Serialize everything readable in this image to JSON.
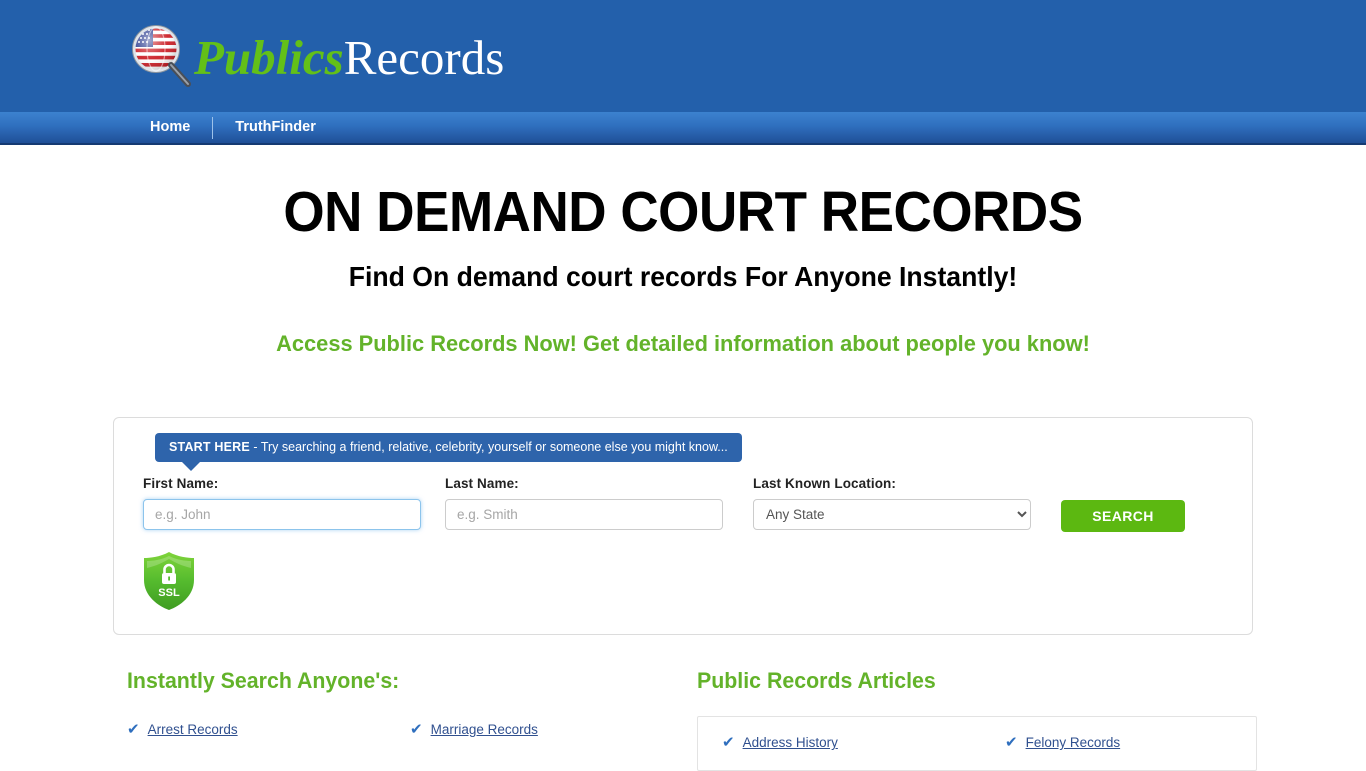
{
  "header": {
    "logo": {
      "icon": "magnifier-usflag-icon",
      "text_green": "Publics",
      "text_white": "Records"
    },
    "brand_blue": "#2360ab"
  },
  "nav": {
    "items": [
      {
        "label": "Home",
        "name": "nav-item-home"
      },
      {
        "label": "TruthFinder",
        "name": "nav-item-truthfinder"
      }
    ]
  },
  "hero": {
    "title": "ON DEMAND COURT RECORDS",
    "subtitle": "Find On demand court records For Anyone Instantly!",
    "tagline": "Access Public Records Now! Get detailed information about people you know!",
    "tagline_color": "#63b32a"
  },
  "search": {
    "callout_strong": "START HERE",
    "callout_rest": " - Try searching a friend, relative, celebrity, yourself or someone else you might know...",
    "first_name": {
      "label": "First Name:",
      "placeholder": "e.g. John",
      "value": ""
    },
    "last_name": {
      "label": "Last Name:",
      "placeholder": "e.g. Smith",
      "value": ""
    },
    "location": {
      "label": "Last Known Location:",
      "selected": "Any State",
      "options": [
        "Any State"
      ]
    },
    "button_label": "SEARCH",
    "button_color": "#5cb811",
    "ssl_badge_label": "SSL"
  },
  "sections": {
    "instant": {
      "heading": "Instantly Search Anyone's:",
      "links": [
        "Arrest Records",
        "Marriage Records"
      ]
    },
    "articles": {
      "heading": "Public Records Articles",
      "links": [
        "Address History",
        "Felony Records"
      ]
    }
  }
}
